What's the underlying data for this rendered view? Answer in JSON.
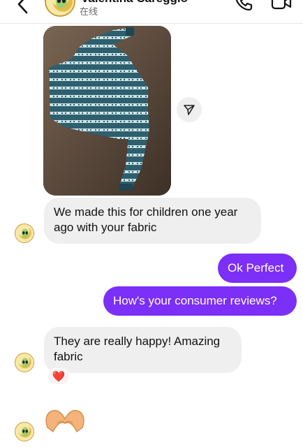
{
  "header": {
    "contact_name": "Valentina Careggio",
    "status": "在线",
    "icons": [
      "back-chevron-icon",
      "alien-avatar",
      "phone-icon",
      "video-camera-icon"
    ]
  },
  "messages": [
    {
      "kind": "image",
      "direction": "incoming",
      "alt": "blue printed long-sleeve children's top",
      "action_icon": "share-icon"
    },
    {
      "kind": "text",
      "direction": "incoming",
      "text": "We made this for children one year ago with your fabric"
    },
    {
      "kind": "text",
      "direction": "outgoing",
      "text": "Ok Perfect"
    },
    {
      "kind": "text",
      "direction": "outgoing",
      "text": "How's your consumer reviews?"
    },
    {
      "kind": "text",
      "direction": "incoming",
      "text": "They are really happy! Amazing fabric",
      "reaction": "❤️"
    },
    {
      "kind": "emoji",
      "direction": "incoming",
      "emoji": "heart-hands-emoji"
    }
  ],
  "colors": {
    "outgoing_bubble": "#7b2ff7",
    "incoming_bubble": "#efefef",
    "reaction_heart": "#e0162b"
  }
}
